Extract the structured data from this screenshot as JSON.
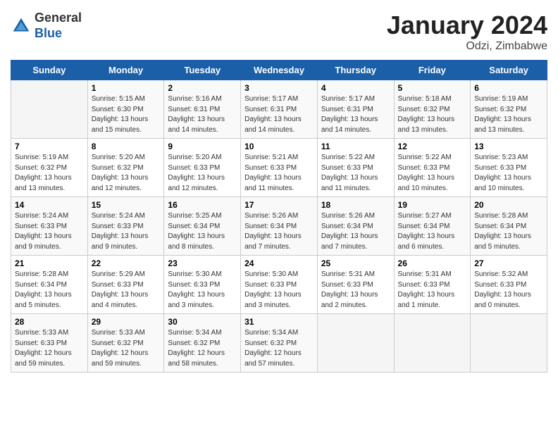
{
  "header": {
    "logo_general": "General",
    "logo_blue": "Blue",
    "month": "January 2024",
    "location": "Odzi, Zimbabwe"
  },
  "days_of_week": [
    "Sunday",
    "Monday",
    "Tuesday",
    "Wednesday",
    "Thursday",
    "Friday",
    "Saturday"
  ],
  "weeks": [
    [
      {
        "num": "",
        "info": ""
      },
      {
        "num": "1",
        "info": "Sunrise: 5:15 AM\nSunset: 6:30 PM\nDaylight: 13 hours\nand 15 minutes."
      },
      {
        "num": "2",
        "info": "Sunrise: 5:16 AM\nSunset: 6:31 PM\nDaylight: 13 hours\nand 14 minutes."
      },
      {
        "num": "3",
        "info": "Sunrise: 5:17 AM\nSunset: 6:31 PM\nDaylight: 13 hours\nand 14 minutes."
      },
      {
        "num": "4",
        "info": "Sunrise: 5:17 AM\nSunset: 6:31 PM\nDaylight: 13 hours\nand 14 minutes."
      },
      {
        "num": "5",
        "info": "Sunrise: 5:18 AM\nSunset: 6:32 PM\nDaylight: 13 hours\nand 13 minutes."
      },
      {
        "num": "6",
        "info": "Sunrise: 5:19 AM\nSunset: 6:32 PM\nDaylight: 13 hours\nand 13 minutes."
      }
    ],
    [
      {
        "num": "7",
        "info": "Sunrise: 5:19 AM\nSunset: 6:32 PM\nDaylight: 13 hours\nand 13 minutes."
      },
      {
        "num": "8",
        "info": "Sunrise: 5:20 AM\nSunset: 6:32 PM\nDaylight: 13 hours\nand 12 minutes."
      },
      {
        "num": "9",
        "info": "Sunrise: 5:20 AM\nSunset: 6:33 PM\nDaylight: 13 hours\nand 12 minutes."
      },
      {
        "num": "10",
        "info": "Sunrise: 5:21 AM\nSunset: 6:33 PM\nDaylight: 13 hours\nand 11 minutes."
      },
      {
        "num": "11",
        "info": "Sunrise: 5:22 AM\nSunset: 6:33 PM\nDaylight: 13 hours\nand 11 minutes."
      },
      {
        "num": "12",
        "info": "Sunrise: 5:22 AM\nSunset: 6:33 PM\nDaylight: 13 hours\nand 10 minutes."
      },
      {
        "num": "13",
        "info": "Sunrise: 5:23 AM\nSunset: 6:33 PM\nDaylight: 13 hours\nand 10 minutes."
      }
    ],
    [
      {
        "num": "14",
        "info": "Sunrise: 5:24 AM\nSunset: 6:33 PM\nDaylight: 13 hours\nand 9 minutes."
      },
      {
        "num": "15",
        "info": "Sunrise: 5:24 AM\nSunset: 6:33 PM\nDaylight: 13 hours\nand 9 minutes."
      },
      {
        "num": "16",
        "info": "Sunrise: 5:25 AM\nSunset: 6:34 PM\nDaylight: 13 hours\nand 8 minutes."
      },
      {
        "num": "17",
        "info": "Sunrise: 5:26 AM\nSunset: 6:34 PM\nDaylight: 13 hours\nand 7 minutes."
      },
      {
        "num": "18",
        "info": "Sunrise: 5:26 AM\nSunset: 6:34 PM\nDaylight: 13 hours\nand 7 minutes."
      },
      {
        "num": "19",
        "info": "Sunrise: 5:27 AM\nSunset: 6:34 PM\nDaylight: 13 hours\nand 6 minutes."
      },
      {
        "num": "20",
        "info": "Sunrise: 5:28 AM\nSunset: 6:34 PM\nDaylight: 13 hours\nand 5 minutes."
      }
    ],
    [
      {
        "num": "21",
        "info": "Sunrise: 5:28 AM\nSunset: 6:34 PM\nDaylight: 13 hours\nand 5 minutes."
      },
      {
        "num": "22",
        "info": "Sunrise: 5:29 AM\nSunset: 6:33 PM\nDaylight: 13 hours\nand 4 minutes."
      },
      {
        "num": "23",
        "info": "Sunrise: 5:30 AM\nSunset: 6:33 PM\nDaylight: 13 hours\nand 3 minutes."
      },
      {
        "num": "24",
        "info": "Sunrise: 5:30 AM\nSunset: 6:33 PM\nDaylight: 13 hours\nand 3 minutes."
      },
      {
        "num": "25",
        "info": "Sunrise: 5:31 AM\nSunset: 6:33 PM\nDaylight: 13 hours\nand 2 minutes."
      },
      {
        "num": "26",
        "info": "Sunrise: 5:31 AM\nSunset: 6:33 PM\nDaylight: 13 hours\nand 1 minute."
      },
      {
        "num": "27",
        "info": "Sunrise: 5:32 AM\nSunset: 6:33 PM\nDaylight: 13 hours\nand 0 minutes."
      }
    ],
    [
      {
        "num": "28",
        "info": "Sunrise: 5:33 AM\nSunset: 6:33 PM\nDaylight: 12 hours\nand 59 minutes."
      },
      {
        "num": "29",
        "info": "Sunrise: 5:33 AM\nSunset: 6:32 PM\nDaylight: 12 hours\nand 59 minutes."
      },
      {
        "num": "30",
        "info": "Sunrise: 5:34 AM\nSunset: 6:32 PM\nDaylight: 12 hours\nand 58 minutes."
      },
      {
        "num": "31",
        "info": "Sunrise: 5:34 AM\nSunset: 6:32 PM\nDaylight: 12 hours\nand 57 minutes."
      },
      {
        "num": "",
        "info": ""
      },
      {
        "num": "",
        "info": ""
      },
      {
        "num": "",
        "info": ""
      }
    ]
  ]
}
